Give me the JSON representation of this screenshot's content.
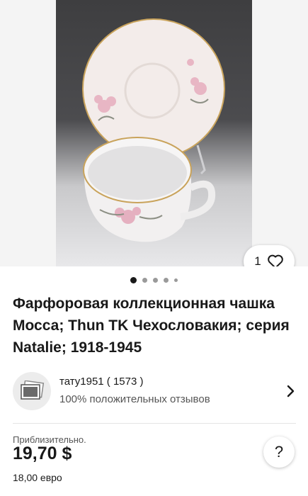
{
  "listing": {
    "title": "Фарфоровая коллекционная чашка Мосса; Thun TK Чехословакия; серия Natalie; 1918-1945",
    "watch_count": "1",
    "image_count": 5,
    "active_image_index": 0
  },
  "seller": {
    "name": "тату1951 ( 1573 )",
    "feedback": "100% положительных отзывов"
  },
  "price": {
    "approx_label": "Приблизительно.",
    "value": "19,70 $",
    "converted": "18,00 евро"
  },
  "help": {
    "label": "?"
  },
  "icons": {
    "like": "heart-icon",
    "seller_avatar": "photo-placeholder-icon",
    "chevron": "chevron-right-icon"
  },
  "colors": {
    "text": "#191919",
    "muted": "#555555",
    "background": "#ffffff"
  }
}
